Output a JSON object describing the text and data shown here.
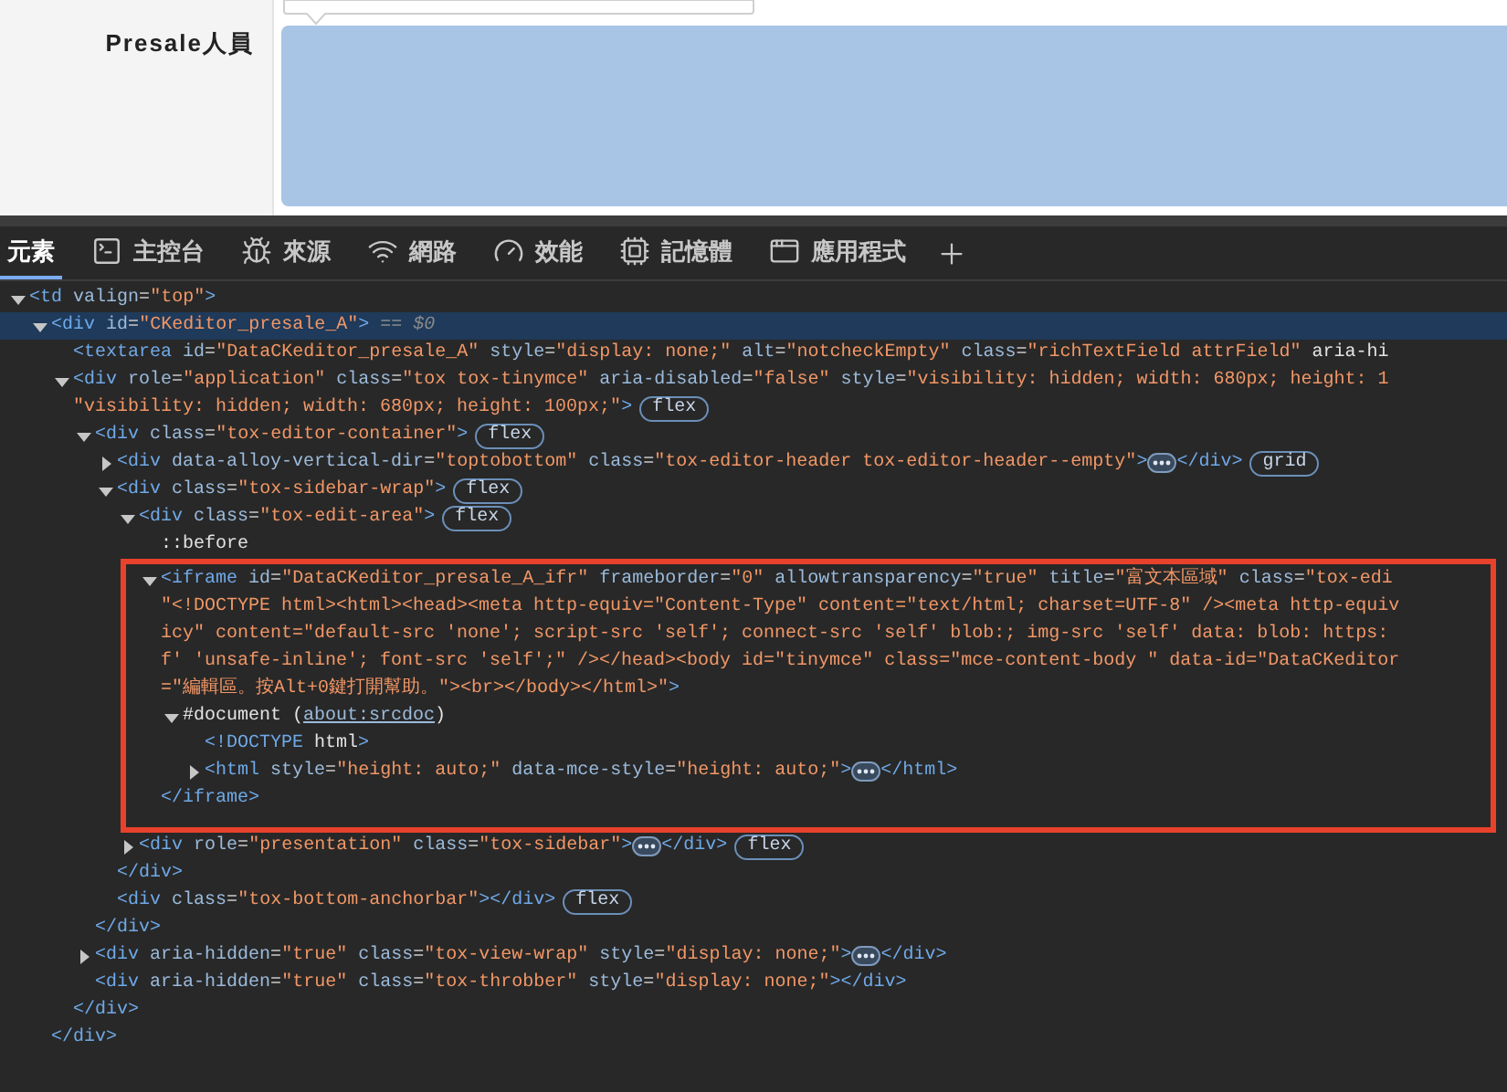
{
  "form_row": {
    "label": "Presale人員"
  },
  "devtools_tabs": [
    {
      "label": "元素",
      "selected": true
    },
    {
      "label": "主控台",
      "selected": false
    },
    {
      "label": "來源",
      "selected": false
    },
    {
      "label": "網路",
      "selected": false
    },
    {
      "label": "效能",
      "selected": false
    },
    {
      "label": "記憶體",
      "selected": false
    },
    {
      "label": "應用程式",
      "selected": false
    }
  ],
  "dom_tree": [
    {
      "text": "<td valign=\"top\">",
      "expanded": true,
      "selected": false,
      "children": [
        {
          "text": "<div id=\"CKeditor_presale_A\">",
          "suffix": "== $0",
          "expanded": true,
          "selected": true,
          "close": "</div>",
          "children": [
            {
              "text": "<textarea id=\"DataCKeditor_presale_A\" style=\"display: none;\" alt=\"notcheckEmpty\" class=\"richTextField attrField\" aria-hi",
              "selected": false
            },
            {
              "text": "<div role=\"application\" class=\"tox tox-tinymce\" aria-disabled=\"false\" style=\"visibility: hidden; width: 680px; height: 1",
              "wrap": [
                "\"visibility: hidden; width: 680px; height: 100px;\">"
              ],
              "badge": "flex",
              "expanded": true,
              "selected": false,
              "close": "</div>",
              "children": [
                {
                  "text": "<div class=\"tox-editor-container\">",
                  "badge": "flex",
                  "expanded": true,
                  "selected": false,
                  "close": "</div>",
                  "children": [
                    {
                      "text": "<div data-alloy-vertical-dir=\"toptobottom\" class=\"tox-editor-header tox-editor-header--empty\">",
                      "tail": "</div>",
                      "badge": "grid",
                      "expanded": false,
                      "selected": false
                    },
                    {
                      "text": "<div class=\"tox-sidebar-wrap\">",
                      "badge": "flex",
                      "expanded": true,
                      "selected": false,
                      "close": "</div>",
                      "children": [
                        {
                          "text": "<div class=\"tox-edit-area\">",
                          "badge": "flex",
                          "expanded": true,
                          "selected": false,
                          "children": [
                            {
                              "text": "::before",
                              "selected": false
                            },
                            {
                              "text": "<iframe id=\"DataCKeditor_presale_A_ifr\" frameborder=\"0\" allowtransparency=\"true\" title=\"富文本區域\" class=\"tox-edi",
                              "wrap": [
                                "\"<!DOCTYPE html><html><head><meta http-equiv=\"Content-Type\" content=\"text/html; charset=UTF-8\" /><meta http-equiv",
                                "icy\" content=\"default-src 'none'; script-src 'self'; connect-src 'self' blob:; img-src 'self' data: blob: https:",
                                "f' 'unsafe-inline'; font-src 'self';\" /></head><body id=\"tinymce\" class=\"mce-content-body \" data-id=\"DataCKeditor",
                                "=\"編輯區。按Alt+0鍵打開幫助。\"><br></body></html>\">"
                              ],
                              "expanded": true,
                              "selected": false,
                              "highlighted": true,
                              "close": "</iframe>",
                              "children": [
                                {
                                  "text": "#document (",
                                  "link": "about:srcdoc",
                                  "text_after": ")",
                                  "expanded": true,
                                  "selected": false,
                                  "children": [
                                    {
                                      "text": "<!DOCTYPE html>",
                                      "selected": false
                                    },
                                    {
                                      "text": "<html style=\"height: auto;\" data-mce-style=\"height: auto;\">",
                                      "tail": "</html>",
                                      "expanded": false,
                                      "selected": false
                                    }
                                  ]
                                }
                              ]
                            }
                          ]
                        },
                        {
                          "text": "<div role=\"presentation\" class=\"tox-sidebar\">",
                          "tail": "</div>",
                          "badge": "flex",
                          "expanded": false,
                          "selected": false
                        }
                      ]
                    },
                    {
                      "text": "<div class=\"tox-bottom-anchorbar\"></div>",
                      "badge": "flex",
                      "selected": false
                    }
                  ]
                },
                {
                  "text": "<div aria-hidden=\"true\" class=\"tox-view-wrap\" style=\"display: none;\">",
                  "tail": "</div>",
                  "expanded": false,
                  "selected": false
                },
                {
                  "text": "<div aria-hidden=\"true\" class=\"tox-throbber\" style=\"display: none;\"></div>",
                  "selected": false
                }
              ]
            }
          ]
        }
      ]
    }
  ]
}
